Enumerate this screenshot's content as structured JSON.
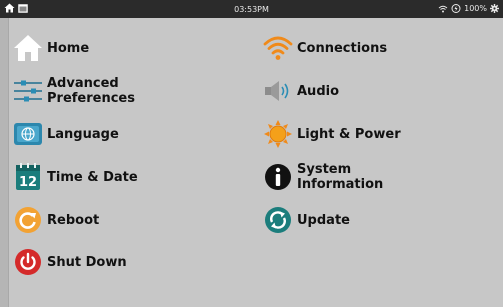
{
  "status_bar": {
    "time": "03:53PM",
    "battery": "100%"
  },
  "menu": {
    "left": [
      {
        "key": "home",
        "label": "Home",
        "icon": "home-icon"
      },
      {
        "key": "advanced-preferences",
        "label": "Advanced\nPreferences",
        "icon": "sliders-icon"
      },
      {
        "key": "language",
        "label": "Language",
        "icon": "globe-icon"
      },
      {
        "key": "time-date",
        "label": "Time & Date",
        "icon": "calendar-icon"
      },
      {
        "key": "reboot",
        "label": "Reboot",
        "icon": "reboot-icon"
      },
      {
        "key": "shut-down",
        "label": "Shut Down",
        "icon": "power-icon"
      }
    ],
    "right": [
      {
        "key": "connections",
        "label": "Connections",
        "icon": "wifi-icon"
      },
      {
        "key": "audio",
        "label": "Audio",
        "icon": "speaker-icon"
      },
      {
        "key": "light-power",
        "label": "Light & Power",
        "icon": "sun-icon"
      },
      {
        "key": "system-information",
        "label": "System\nInformation",
        "icon": "info-icon"
      },
      {
        "key": "update",
        "label": "Update",
        "icon": "update-icon"
      }
    ]
  },
  "calendar_icon_day": "12",
  "colors": {
    "background": "#c7c7c7",
    "status_bar": "#2b2b2b",
    "accent_orange": "#f08a1a",
    "reboot_orange": "#f2a233",
    "power_red": "#d42a2a",
    "teal": "#1b7d7c",
    "info_black": "#111111"
  }
}
